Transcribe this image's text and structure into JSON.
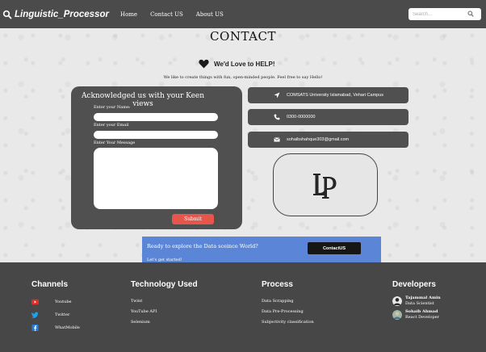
{
  "navbar": {
    "brand": "Linguistic_Processor",
    "links": [
      "Home",
      "Contact US",
      "About US"
    ],
    "search_placeholder": "Search..."
  },
  "contact": {
    "title": "CONTACT",
    "love_text": "We'd Love to HELP!",
    "tagline": "We like to create things with fun, open-minded people. Feel free to say Hello!"
  },
  "form": {
    "title": "Acknowledged us with your Keen views",
    "name_label": "Enter your Name:",
    "email_label": "Enter your Email",
    "message_label": "Enter Your Message",
    "submit_label": "Submit"
  },
  "info": {
    "address": "COMSATS University Islamabad, Vehari Campus",
    "phone": "0300-0000000",
    "email": "sohaibshahque303@gmail.com",
    "icons": [
      "location-arrow-icon",
      "phone-icon",
      "envelope-icon"
    ]
  },
  "cta": {
    "title": "Ready to explore the Data sceince World?",
    "subtitle": "Let's get started!",
    "button": "ContactUS"
  },
  "footer": {
    "channels": {
      "heading": "Channels",
      "items": [
        {
          "label": "Youtube",
          "icon": "youtube-icon",
          "color": "#e52d27"
        },
        {
          "label": "Twitter",
          "icon": "twitter-icon",
          "color": "#1da1f2"
        },
        {
          "label": "WhatMobile",
          "icon": "facebook-icon",
          "color": "#2a7bd8"
        }
      ]
    },
    "technology": {
      "heading": "Technology Used",
      "items": [
        "Twint",
        "YouTube API",
        "Selenium"
      ]
    },
    "process": {
      "heading": "Process",
      "items": [
        "Data Scrapping",
        "Data Pre-Processing",
        "Subjectivity classification"
      ]
    },
    "developers": {
      "heading": "Developers",
      "items": [
        {
          "name": "Tajammal Amin",
          "role": "Data Scientist"
        },
        {
          "name": "Sohaib Ahmad",
          "role": "React Developer"
        }
      ]
    }
  },
  "colors": {
    "navbar": "#4b4b4b",
    "card": "#505050",
    "submit": "#e8554b",
    "cta": "#5b86d8",
    "footer": "#474747"
  }
}
